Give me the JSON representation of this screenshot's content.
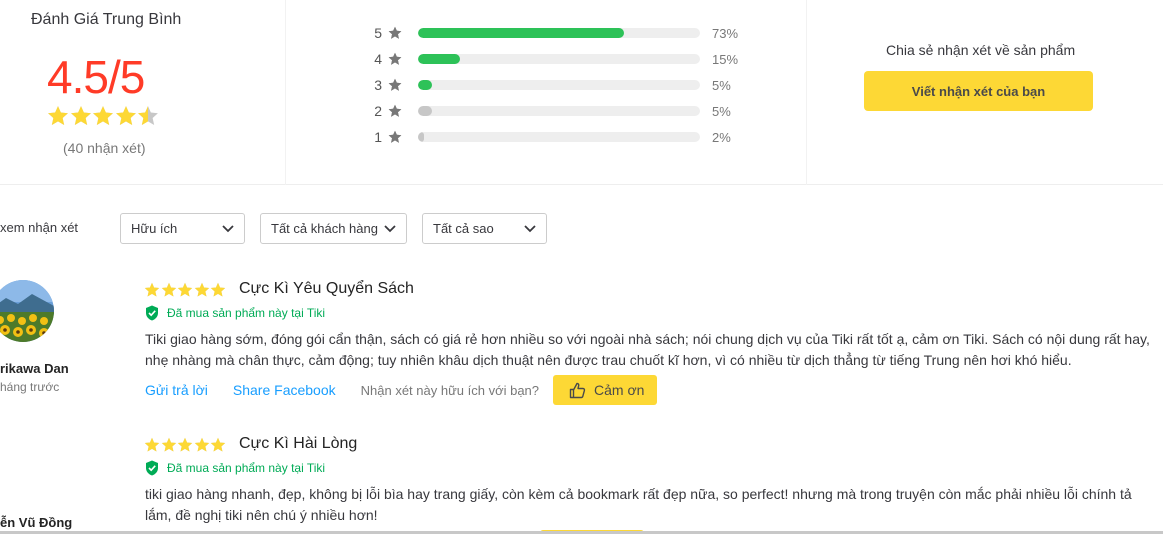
{
  "summary": {
    "title": "Đánh Giá Trung Bình",
    "score": "4.5/5",
    "count": "(40 nhận xét)",
    "rating": 4.5,
    "bars": [
      {
        "stars": "5",
        "percent": 73,
        "label": "73%",
        "color": "#2dc258"
      },
      {
        "stars": "4",
        "percent": 15,
        "label": "15%",
        "color": "#2dc258"
      },
      {
        "stars": "3",
        "percent": 5,
        "label": "5%",
        "color": "#2dc258"
      },
      {
        "stars": "2",
        "percent": 5,
        "label": "5%",
        "color": "#c7c7c7"
      },
      {
        "stars": "1",
        "percent": 2,
        "label": "2%",
        "color": "#c7c7c7"
      }
    ]
  },
  "share": {
    "text": "Chia sẻ nhận xét về sản phẩm",
    "button": "Viết nhận xét của bạn"
  },
  "filter": {
    "label": "xem nhận xét",
    "options": [
      "Hữu ích",
      "Tất cả khách hàng",
      "Tất cả sao"
    ]
  },
  "colors": {
    "accent_yellow": "#fdd835",
    "score_red": "#ff3b27",
    "star_yellow": "#fdd835",
    "green": "#00ab56",
    "link_blue": "#189eff"
  },
  "reviews": [
    {
      "user": "rikawa Dan",
      "time": "háng trước",
      "rating": 5,
      "title": "Cực Kì Yêu Quyển Sách",
      "bought": "Đã mua sản phẩm này tại Tiki",
      "text": "Tiki giao hàng sớm, đóng gói cẩn thận, sách có giá rẻ hơn nhiều so với ngoài nhà sách; nói chung dịch vụ của Tiki rất tốt ạ, cảm ơn Tiki. Sách có nội dung rất hay, nhẹ nhàng mà chân thực, cảm động; tuy nhiên khâu dịch thuật nên được trau chuốt kĩ hơn, vì có nhiều từ dịch thẳng từ tiếng Trung nên hơi khó hiểu.",
      "reply": "Gửi trả lời",
      "share": "Share Facebook",
      "helpful": "Nhận xét này hữu ích với bạn?",
      "thanks": "Cảm ơn"
    },
    {
      "user": "ễn Vũ Đồng",
      "rating": 5,
      "title": "Cực Kì Hài Lòng",
      "bought": "Đã mua sản phẩm này tại Tiki",
      "text": "tiki giao hàng nhanh, đẹp, không bị lỗi bìa hay trang giấy, còn kèm cả bookmark rất đẹp nữa, so perfect! nhưng mà trong truyện còn mắc phải nhiều lỗi chính tả lắm, đề nghị tiki nên chú ý nhiều hơn!"
    }
  ]
}
